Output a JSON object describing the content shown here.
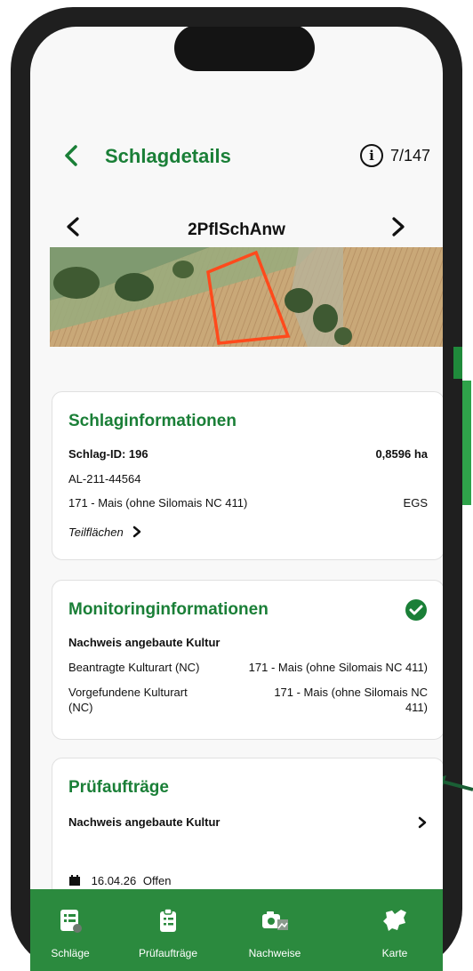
{
  "header": {
    "back_icon": "chevron-left-icon",
    "title": "Schlagdetails",
    "info_icon": "info-icon",
    "info_glyph": "i",
    "counter": "7/147"
  },
  "navigation": {
    "prev_icon": "chevron-left-icon",
    "field_name": "2PflSchAnw",
    "next_icon": "chevron-right-icon"
  },
  "map": {
    "field_outline_color": "#ff4a1c"
  },
  "schlaginfo": {
    "title": "Schlaginformationen",
    "schlag_id": "Schlag-ID: 196",
    "area": "0,8596 ha",
    "code": "AL-211-44564",
    "crop": "171 - Mais (ohne Silomais NC 411)",
    "program": "EGS",
    "subareas_label": "Teilflächen",
    "subareas_chevron": ">"
  },
  "monitoring": {
    "title": "Monitoringinformationen",
    "status_icon": "check-circle-icon",
    "subtitle": "Nachweis angebaute Kultur",
    "row1_label": "Beantragte Kulturart (NC)",
    "row1_value": "171 - Mais (ohne Silomais NC 411)",
    "row2_label_line1": "Vorgefundene Kulturart",
    "row2_label_line2": "(NC)",
    "row2_value_line1": "171 - Mais (ohne Silomais NC",
    "row2_value_line2": "411)"
  },
  "pruefauftraege": {
    "title": "Prüfaufträge",
    "item_label": "Nachweis angebaute Kultur",
    "item_chevron": ">",
    "date_icon": "calendar-icon",
    "date": "16.04.26",
    "status": "Offen"
  },
  "tabs": [
    {
      "label": "Schläge",
      "icon": "field-list-icon"
    },
    {
      "label": "Prüfaufträge",
      "icon": "clipboard-icon"
    },
    {
      "label": "Nachweise",
      "icon": "camera-gallery-icon"
    },
    {
      "label": "Karte",
      "icon": "map-region-icon"
    }
  ],
  "colors": {
    "accent": "#1a7f37",
    "bottom_bar": "#2b8a3e"
  }
}
